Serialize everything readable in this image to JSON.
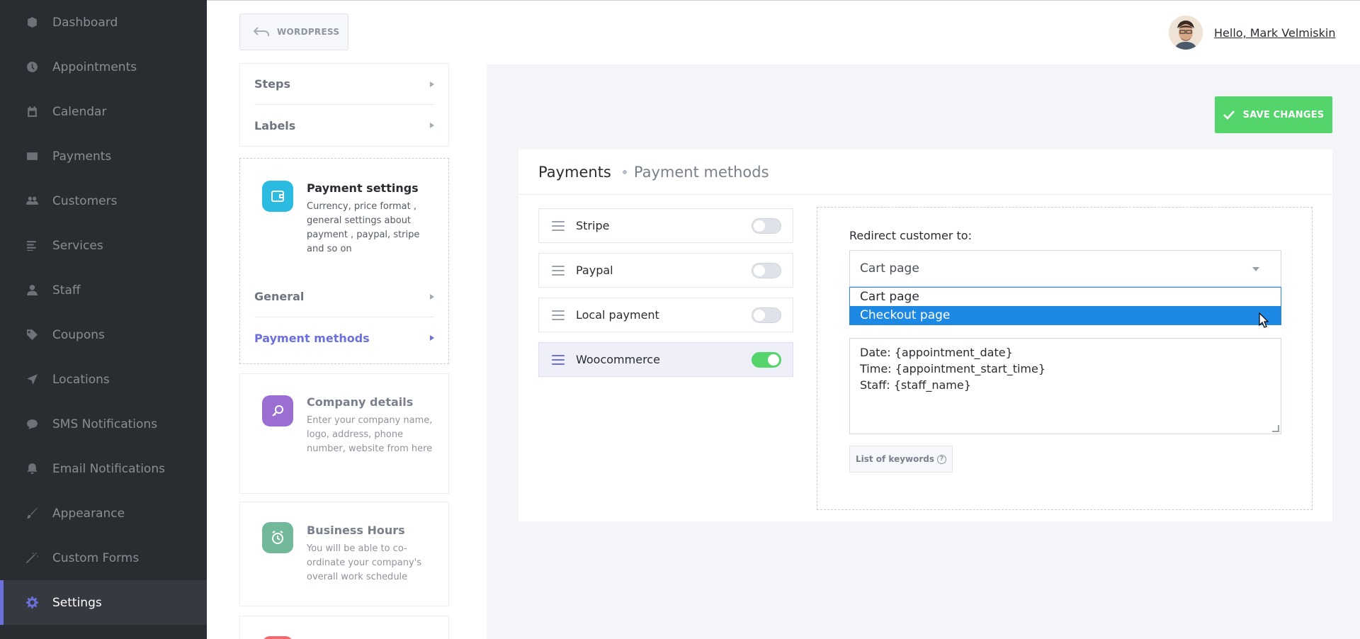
{
  "sidebar": {
    "items": [
      {
        "label": "Dashboard",
        "icon": "cube-icon"
      },
      {
        "label": "Appointments",
        "icon": "clock-icon"
      },
      {
        "label": "Calendar",
        "icon": "calendar-icon"
      },
      {
        "label": "Payments",
        "icon": "credit-card-icon"
      },
      {
        "label": "Customers",
        "icon": "users-icon"
      },
      {
        "label": "Services",
        "icon": "list-icon"
      },
      {
        "label": "Staff",
        "icon": "user-icon"
      },
      {
        "label": "Coupons",
        "icon": "tag-icon"
      },
      {
        "label": "Locations",
        "icon": "location-arrow-icon"
      },
      {
        "label": "SMS Notifications",
        "icon": "chat-bubble-icon"
      },
      {
        "label": "Email Notifications",
        "icon": "bell-icon"
      },
      {
        "label": "Appearance",
        "icon": "brush-icon"
      },
      {
        "label": "Custom Forms",
        "icon": "magic-wand-icon"
      },
      {
        "label": "Settings",
        "icon": "gear-icon",
        "active": true
      }
    ]
  },
  "topbar": {
    "wordpress_label": "WORDPRESS",
    "greeting": "Hello, Mark Velmiskin"
  },
  "settings_menu": {
    "top_items": [
      "Steps",
      "Labels"
    ],
    "payment_card": {
      "title": "Payment settings",
      "description": "Currency, price format , general settings about payment , paypal, stripe and so on",
      "items": [
        "General",
        "Payment methods"
      ]
    },
    "company_card": {
      "title": "Company details",
      "description": "Enter your company name, logo, address, phone number, website from here"
    },
    "hours_card": {
      "title": "Business Hours",
      "description": "You will be able to co-ordinate your company's overall work schedule"
    }
  },
  "actions": {
    "save_label": "SAVE CHANGES"
  },
  "panel": {
    "title": "Payments",
    "subtitle": "Payment methods",
    "methods": [
      {
        "label": "Stripe",
        "enabled": false
      },
      {
        "label": "Paypal",
        "enabled": false
      },
      {
        "label": "Local payment",
        "enabled": false
      },
      {
        "label": "Woocommerce",
        "enabled": true
      }
    ],
    "redirect_label": "Redirect customer to:",
    "redirect_value": "Cart page",
    "redirect_options": [
      "Cart page",
      "Checkout page"
    ],
    "highlighted_option": "Checkout page",
    "template_lines": [
      "Date: {appointment_date}",
      "Time: {appointment_start_time}",
      "Staff: {staff_name}"
    ],
    "keywords_label": "List of keywords"
  },
  "colors": {
    "accent": "#6c70dc",
    "save_green": "#53d56c",
    "sidebar_bg": "#292d32",
    "selection_blue": "#1e88e5"
  }
}
